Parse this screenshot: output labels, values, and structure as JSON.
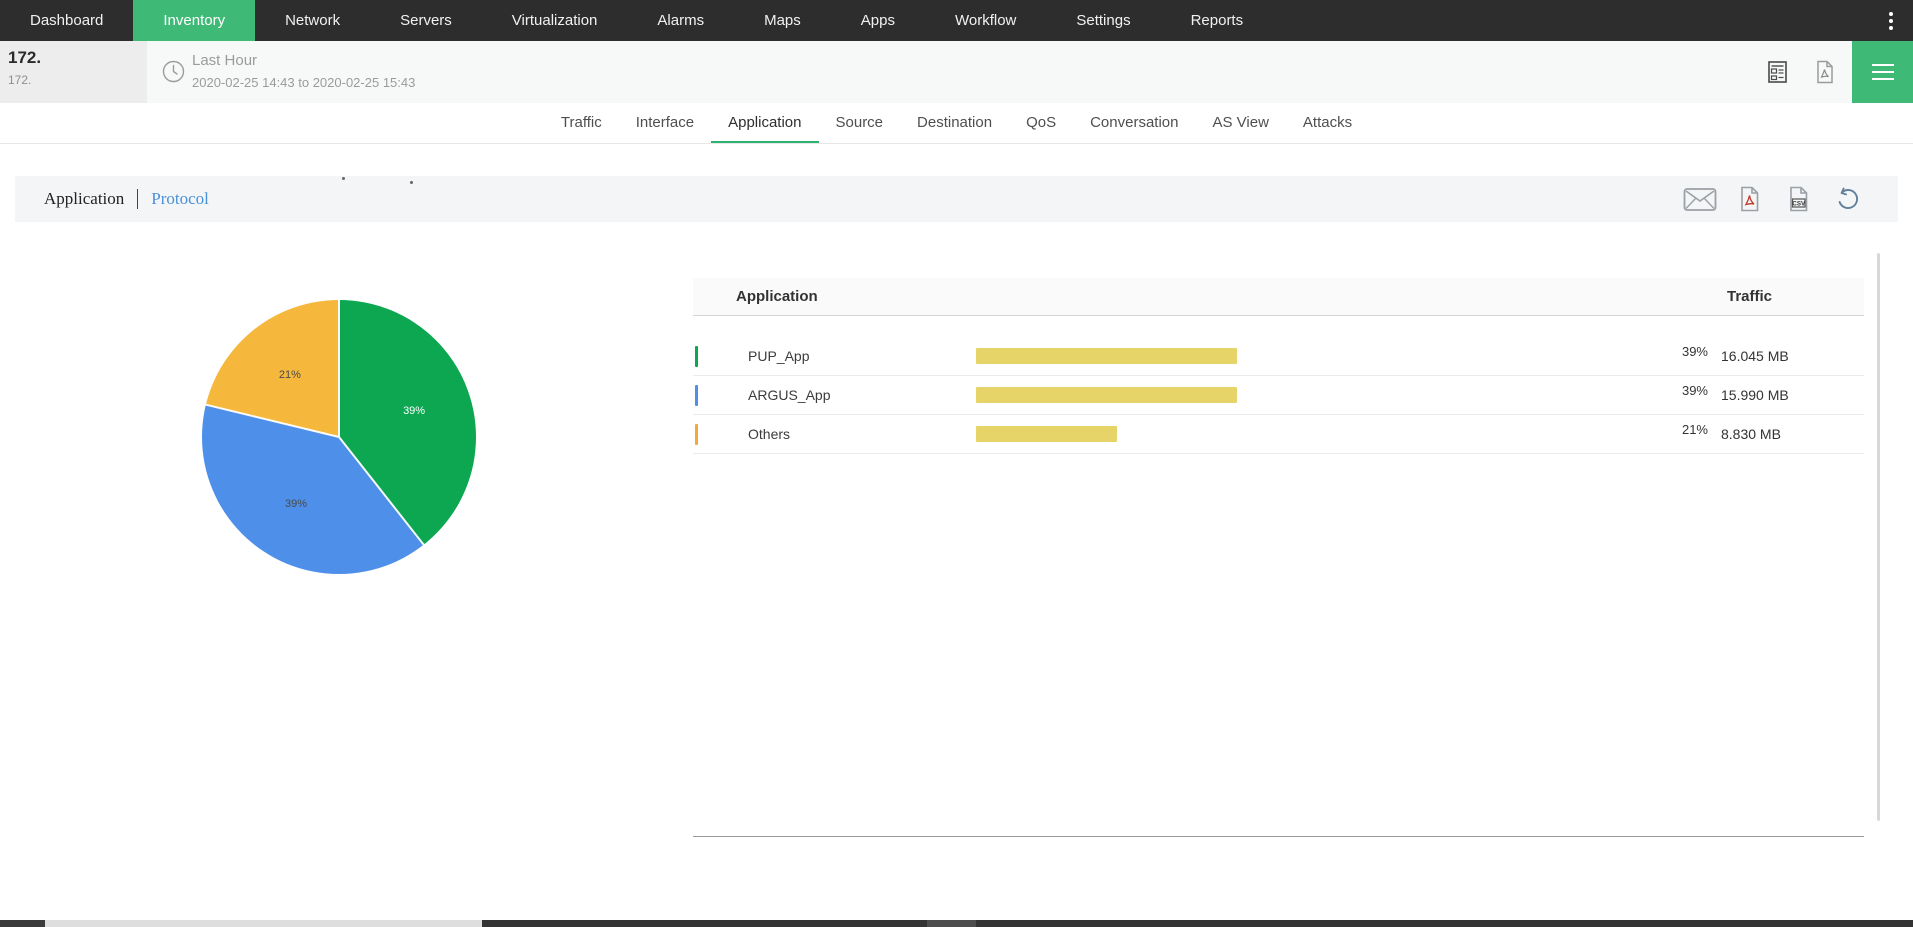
{
  "nav": {
    "items": [
      "Dashboard",
      "Inventory",
      "Network",
      "Servers",
      "Virtualization",
      "Alarms",
      "Maps",
      "Apps",
      "Workflow",
      "Settings",
      "Reports"
    ],
    "active": "Inventory",
    "kebab_icon": "kebab-menu"
  },
  "header": {
    "device_name": "172.",
    "device_sub": "172.",
    "period_label": "Last Hour",
    "period_range": "2020-02-25 14:43 to 2020-02-25 15:43",
    "icons": [
      "clock",
      "report",
      "pdf-export",
      "menu"
    ]
  },
  "tabs": {
    "items": [
      "Traffic",
      "Interface",
      "Application",
      "Source",
      "Destination",
      "QoS",
      "Conversation",
      "AS View",
      "Attacks"
    ],
    "active": "Application"
  },
  "subnav": {
    "items": [
      {
        "label": "Application",
        "active": true
      },
      {
        "label": "Protocol",
        "active": false
      }
    ],
    "icons": [
      "email",
      "pdf",
      "csv",
      "reset"
    ]
  },
  "chart_data": {
    "type": "pie",
    "title": "",
    "labels": [
      "PUP_App",
      "ARGUS_App",
      "Others"
    ],
    "values": [
      39,
      39,
      21
    ],
    "unit": "%",
    "slice_labels": [
      "39%",
      "39%",
      "21%"
    ],
    "colors": [
      "#0ca750",
      "#4d8fe9",
      "#f5b83d"
    ],
    "slice_label_colors": [
      "#ffffff",
      "#4a4a4a",
      "#4a4a4a"
    ],
    "start_angle_deg": 0,
    "direction": "clockwise",
    "legend_position": "none"
  },
  "table": {
    "columns": [
      "Application",
      "Traffic"
    ],
    "rows": [
      {
        "name": "PUP_App",
        "tick_color": "#0ca750",
        "percent": 39,
        "percent_label": "39%",
        "traffic": "16.045 MB"
      },
      {
        "name": "ARGUS_App",
        "tick_color": "#4d8fe9",
        "percent": 39,
        "percent_label": "39%",
        "traffic": "15.990 MB"
      },
      {
        "name": "Others",
        "tick_color": "#f5a93c",
        "percent": 21,
        "percent_label": "21%",
        "traffic": "8.830 MB"
      }
    ],
    "bar_color": "#e7d469"
  },
  "colors": {
    "accent_green": "#3fba76",
    "tab_underline_green": "#2db36f",
    "nav_bg": "#2d2d2d",
    "protocol_blue": "#4a90d9",
    "icon_gray": "#9aa0a6"
  }
}
